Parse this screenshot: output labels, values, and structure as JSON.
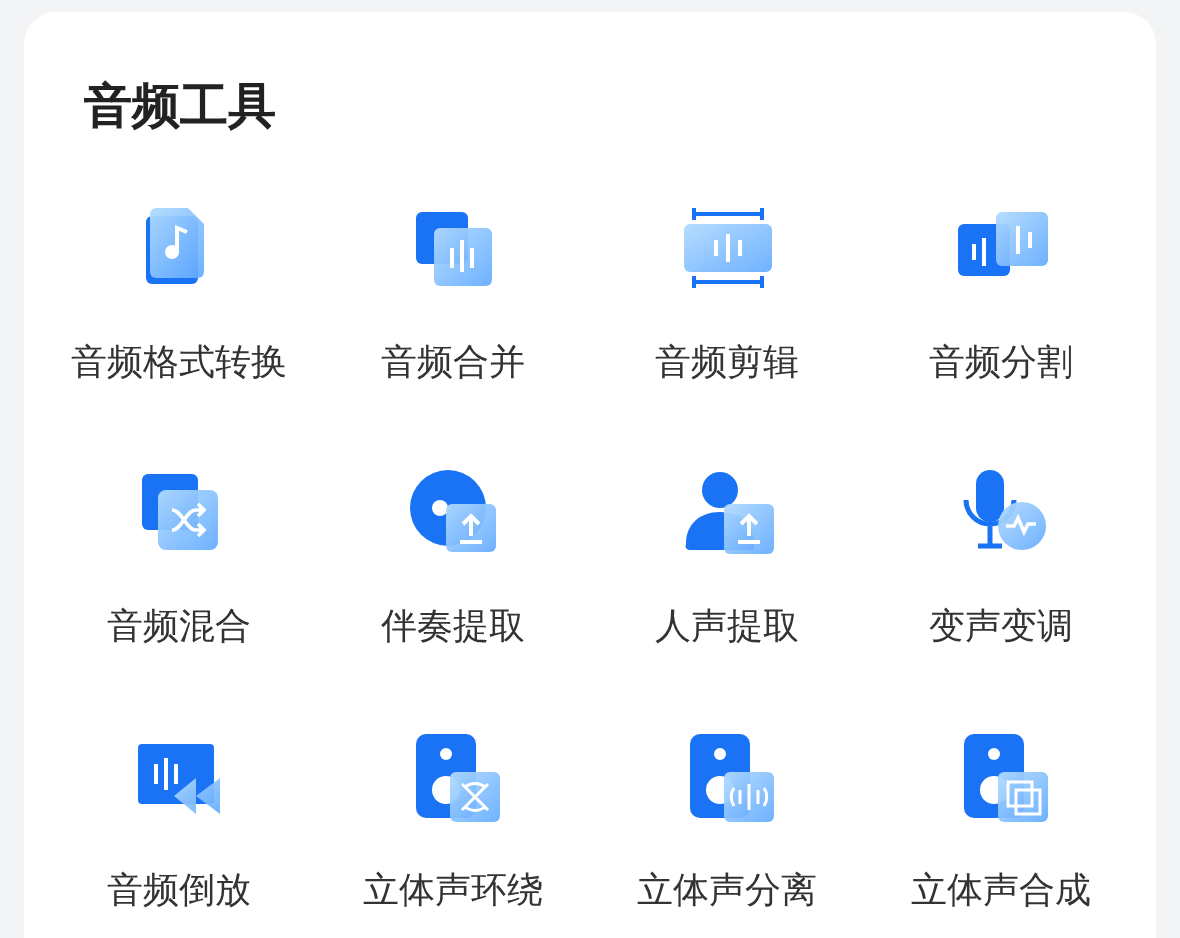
{
  "section": {
    "title": "音频工具"
  },
  "tools": [
    {
      "label": "音频格式转换",
      "kind": "music-file"
    },
    {
      "label": "音频合并",
      "kind": "merge"
    },
    {
      "label": "音频剪辑",
      "kind": "trim"
    },
    {
      "label": "音频分割",
      "kind": "split"
    },
    {
      "label": "音频混合",
      "kind": "mix"
    },
    {
      "label": "伴奏提取",
      "kind": "accompaniment"
    },
    {
      "label": "人声提取",
      "kind": "vocal"
    },
    {
      "label": "变声变调",
      "kind": "voice-change"
    },
    {
      "label": "音频倒放",
      "kind": "reverse"
    },
    {
      "label": "立体声环绕",
      "kind": "surround"
    },
    {
      "label": "立体声分离",
      "kind": "separate"
    },
    {
      "label": "立体声合成",
      "kind": "combine"
    }
  ]
}
